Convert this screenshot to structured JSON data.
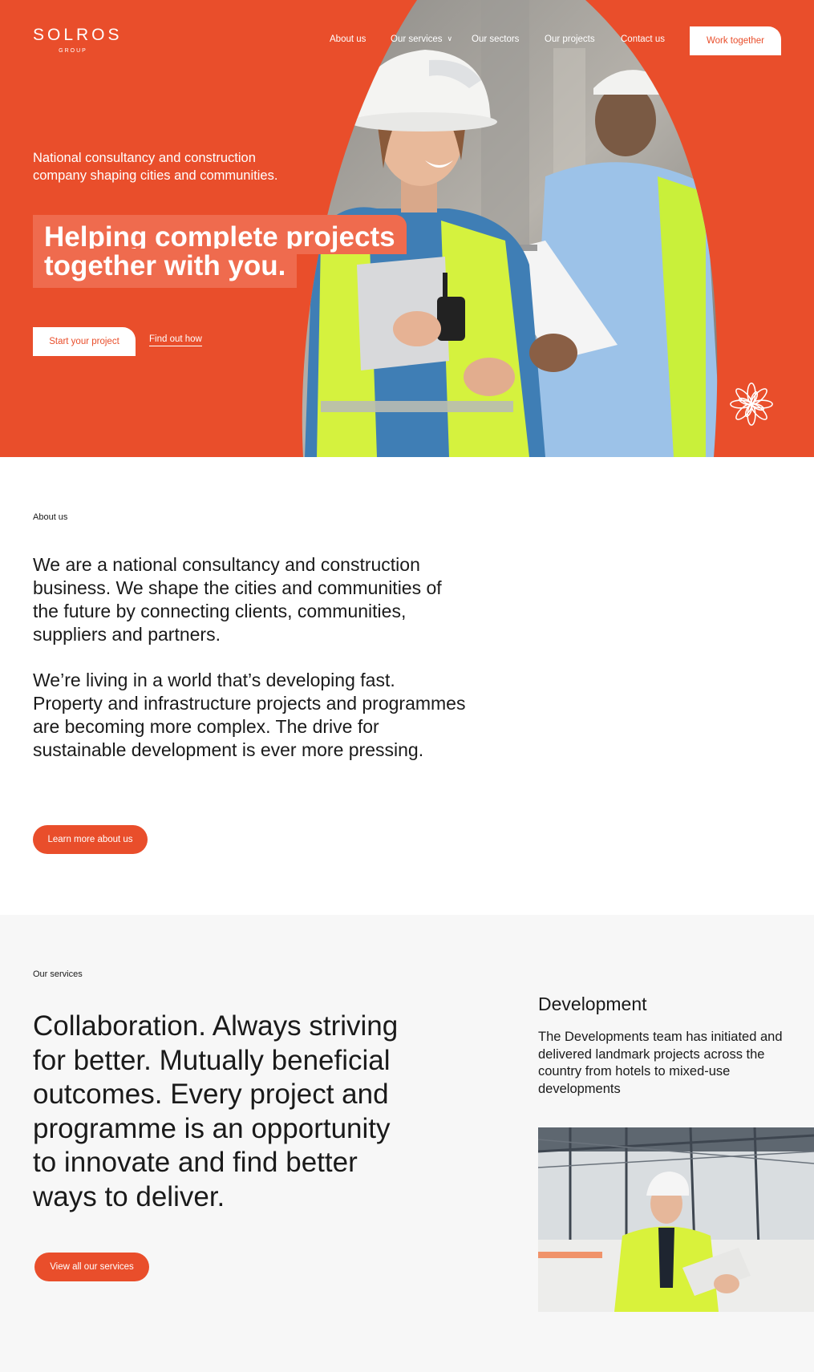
{
  "brand": {
    "logo_word": "SOLROS",
    "logo_sub": "GROUP",
    "accent": "#E94E2B",
    "accent_light": "#EF6B4E",
    "services_bg": "#F7F7F7"
  },
  "nav": {
    "items": [
      {
        "label": "About us"
      },
      {
        "label": "Our services",
        "has_dropdown": true
      },
      {
        "label": "Our sectors"
      },
      {
        "label": "Our projects"
      },
      {
        "label": "Contact us"
      }
    ],
    "cta": "Work together"
  },
  "hero": {
    "subtitle": "National consultancy and construction company shaping cities and communities.",
    "title_line1": "Helping complete projects",
    "title_line2": "together with you.",
    "primary_button": "Start your project",
    "secondary_link": "Find out how",
    "photo_icon": "construction-workers-photo",
    "emblem_icon": "flower-emblem-icon"
  },
  "about": {
    "eyebrow": "About us",
    "paragraph1": "We are a national consultancy and construction business. We shape the cities and communities of the future by connecting clients, communities, suppliers and partners.",
    "paragraph2": "We’re living in a world that’s developing fast. Property and infrastructure projects and programmes are becoming more complex. The drive for sustainable development is ever more pressing.",
    "button": "Learn more about us"
  },
  "services": {
    "eyebrow": "Our services",
    "heading": "Collaboration. Always striving for better. Mutually beneficial outcomes. Every project and programme is an opportunity to innovate and find better ways to deliver.",
    "button": "View all our services",
    "card": {
      "title": "Development",
      "text": "The Developments team has initiated and delivered landmark projects across the country from hotels to mixed-use developments",
      "photo_icon": "construction-worker-with-tablet-photo"
    }
  }
}
